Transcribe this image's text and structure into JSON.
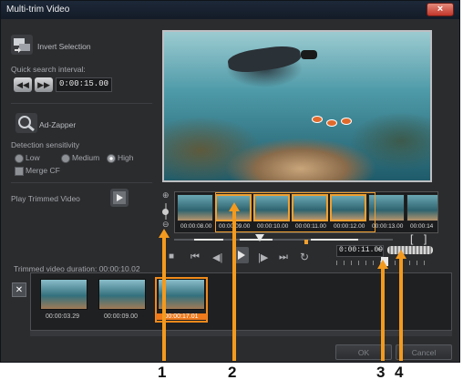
{
  "window": {
    "title": "Multi-trim Video",
    "close_label": "×"
  },
  "left_panel": {
    "invert_selection": "Invert Selection",
    "quick_search_label": "Quick search interval:",
    "quick_search_time": "0:00:15.00",
    "ad_zapper": "Ad-Zapper",
    "detection_sensitivity": "Detection sensitivity",
    "sensitivity": {
      "low": "Low",
      "medium": "Medium",
      "high": "High",
      "selected": "High"
    },
    "merge_cf": "Merge CF",
    "play_trimmed": "Play Trimmed Video"
  },
  "timeline": {
    "timecodes": [
      "00:00:08.00",
      "00:00:09.00",
      "00:00:10.00",
      "00:00:11.00",
      "00:00:12.00",
      "00:00:13.00",
      "00:00:14"
    ],
    "current_time": "0:00:11.09",
    "mark_in": "[",
    "mark_out": "]"
  },
  "trimmed_duration": "Trimmed video duration: 00:00:10.02",
  "clips": [
    {
      "label": "00:00:03.29",
      "selected": false
    },
    {
      "label": "00:00:09.00",
      "selected": false
    },
    {
      "label": "00:00:17.01",
      "selected": true
    }
  ],
  "buttons": {
    "ok": "OK",
    "cancel": "Cancel",
    "delete": "✕"
  },
  "callouts": [
    "1",
    "2",
    "3",
    "4"
  ],
  "colors": {
    "accent": "#f39a1e",
    "selection": "#f0a030"
  }
}
